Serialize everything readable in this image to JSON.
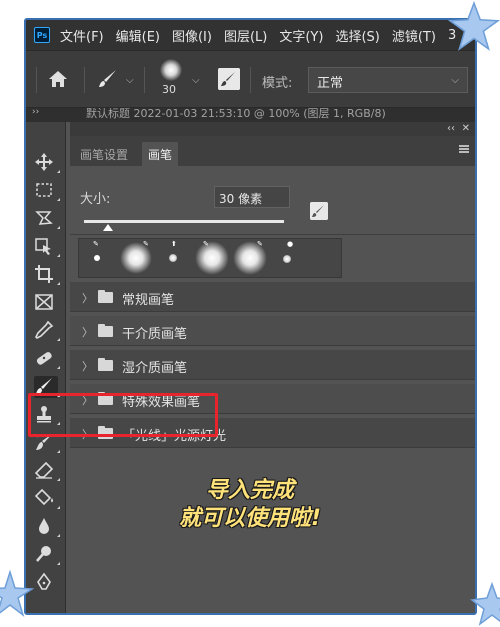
{
  "menubar": {
    "logo": "Ps",
    "items": [
      "文件(F)",
      "编辑(E)",
      "图像(I)",
      "图层(L)",
      "文字(Y)",
      "选择(S)",
      "滤镜(T)",
      "3"
    ]
  },
  "options": {
    "brush_size": "30",
    "mode_label": "模式:",
    "mode_value": "正常"
  },
  "doc_tab": {
    "expand": "››",
    "title": "默认标题 2022-01-03 21:53:10 @ 100% (图层 1, RGB/8)"
  },
  "panel": {
    "collapse": "‹‹",
    "close": "✕",
    "tabs": [
      "画笔设置",
      "画笔"
    ],
    "active_tab": "画笔",
    "size_label": "大小:",
    "size_value": "30 像素",
    "slider_fraction": 0.12,
    "folders": [
      "常规画笔",
      "干介质画笔",
      "湿介质画笔",
      "特殊效果画笔",
      "「光线」光源灯光"
    ]
  },
  "caption": {
    "line1": "导入完成",
    "line2": "就可以使用啦!"
  },
  "colors": {
    "highlight": "#e8242c",
    "caption": "#ffe27a",
    "frame_border": "#3a6fb0",
    "star": "#a9c8ef"
  },
  "icons": [
    "home-icon",
    "brush-icon",
    "move-icon",
    "marquee-icon",
    "lasso-icon",
    "crop-icon",
    "frame-icon",
    "eyedropper-icon",
    "healing-icon",
    "brush-tool-icon",
    "stamp-icon",
    "history-brush-icon",
    "eraser-icon",
    "paint-bucket-icon",
    "blur-icon",
    "dodge-icon",
    "pen-icon",
    "folder-icon",
    "chevron-right-icon",
    "star-icon"
  ]
}
